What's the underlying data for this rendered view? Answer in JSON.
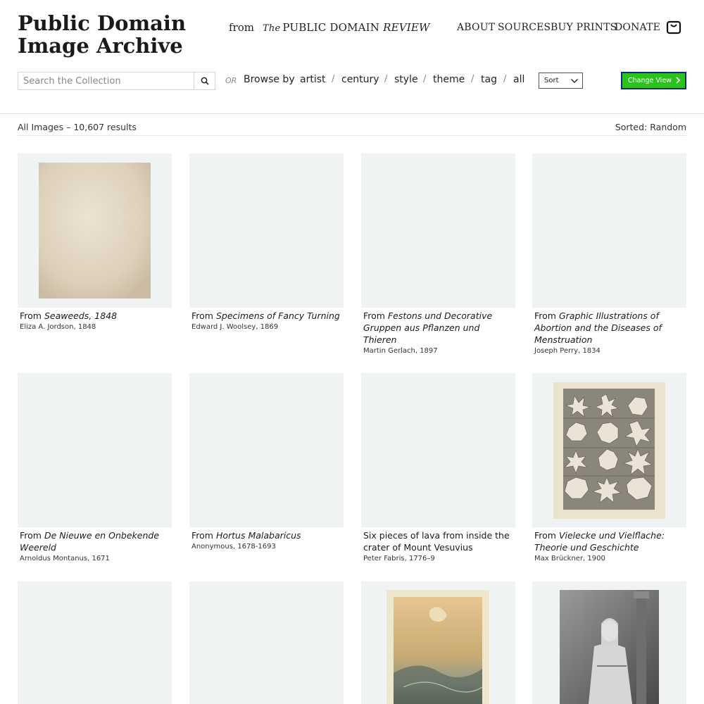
{
  "site": {
    "title": "Public Domain Image Archive",
    "from_label": "from",
    "publisher_the": "The",
    "publisher_name": "PUBLIC DOMAIN",
    "publisher_review": "REVIEW"
  },
  "nav": {
    "items": [
      {
        "label": "ABOUT"
      },
      {
        "label": "SOURCES"
      },
      {
        "label": "BUY PRINTS"
      },
      {
        "label": "DONATE"
      }
    ],
    "cart_icon": "shopping-bag-icon"
  },
  "search": {
    "placeholder": "Search the Collection",
    "value": "",
    "button_icon": "search-icon"
  },
  "browse": {
    "or_label": "OR",
    "label": "Browse by",
    "options": [
      "artist",
      "century",
      "style",
      "theme",
      "tag",
      "all"
    ],
    "separator": "/"
  },
  "sort": {
    "label": "Sort"
  },
  "change_view": {
    "label": "Change View",
    "color": "#2bc21e",
    "outline_color": "#1a1f8c"
  },
  "results": {
    "count_text": "All Images – 10,607 results",
    "sorted_text": "Sorted: Random"
  },
  "cards": [
    {
      "prefix": "From ",
      "title": "Seaweeds, 1848",
      "meta": "Eliza A. Jordson, 1848"
    },
    {
      "prefix": "From ",
      "title": "Specimens of Fancy Turning",
      "meta": "Edward J. Woolsey, 1869"
    },
    {
      "prefix": "From ",
      "title": "Festons und Decorative Gruppen aus Pflanzen und Thieren",
      "meta": "Martin Gerlach, 1897"
    },
    {
      "prefix": "From ",
      "title": "Graphic Illustrations of Abortion and the Diseases of Menstruation",
      "meta": "Joseph Perry, 1834"
    },
    {
      "prefix": "From ",
      "title": "De Nieuwe en Onbekende Weereld",
      "meta": "Arnoldus Montanus, 1671"
    },
    {
      "prefix": "From ",
      "title": "Hortus Malabaricus",
      "meta": "Anonymous, 1678-1693"
    },
    {
      "prefix": "",
      "title": "Six pieces of lava from inside the crater of Mount Vesuvius",
      "meta": "Peter Fabris, 1776–9"
    },
    {
      "prefix": "From ",
      "title": "Vielecke und Vielflache: Theorie und Geschichte",
      "meta": "Max Brückner, 1900"
    },
    {
      "prefix": "",
      "title": "",
      "meta": ""
    },
    {
      "prefix": "",
      "title": "",
      "meta": ""
    },
    {
      "prefix": "",
      "title": "",
      "meta": ""
    },
    {
      "prefix": "",
      "title": "",
      "meta": ""
    }
  ]
}
